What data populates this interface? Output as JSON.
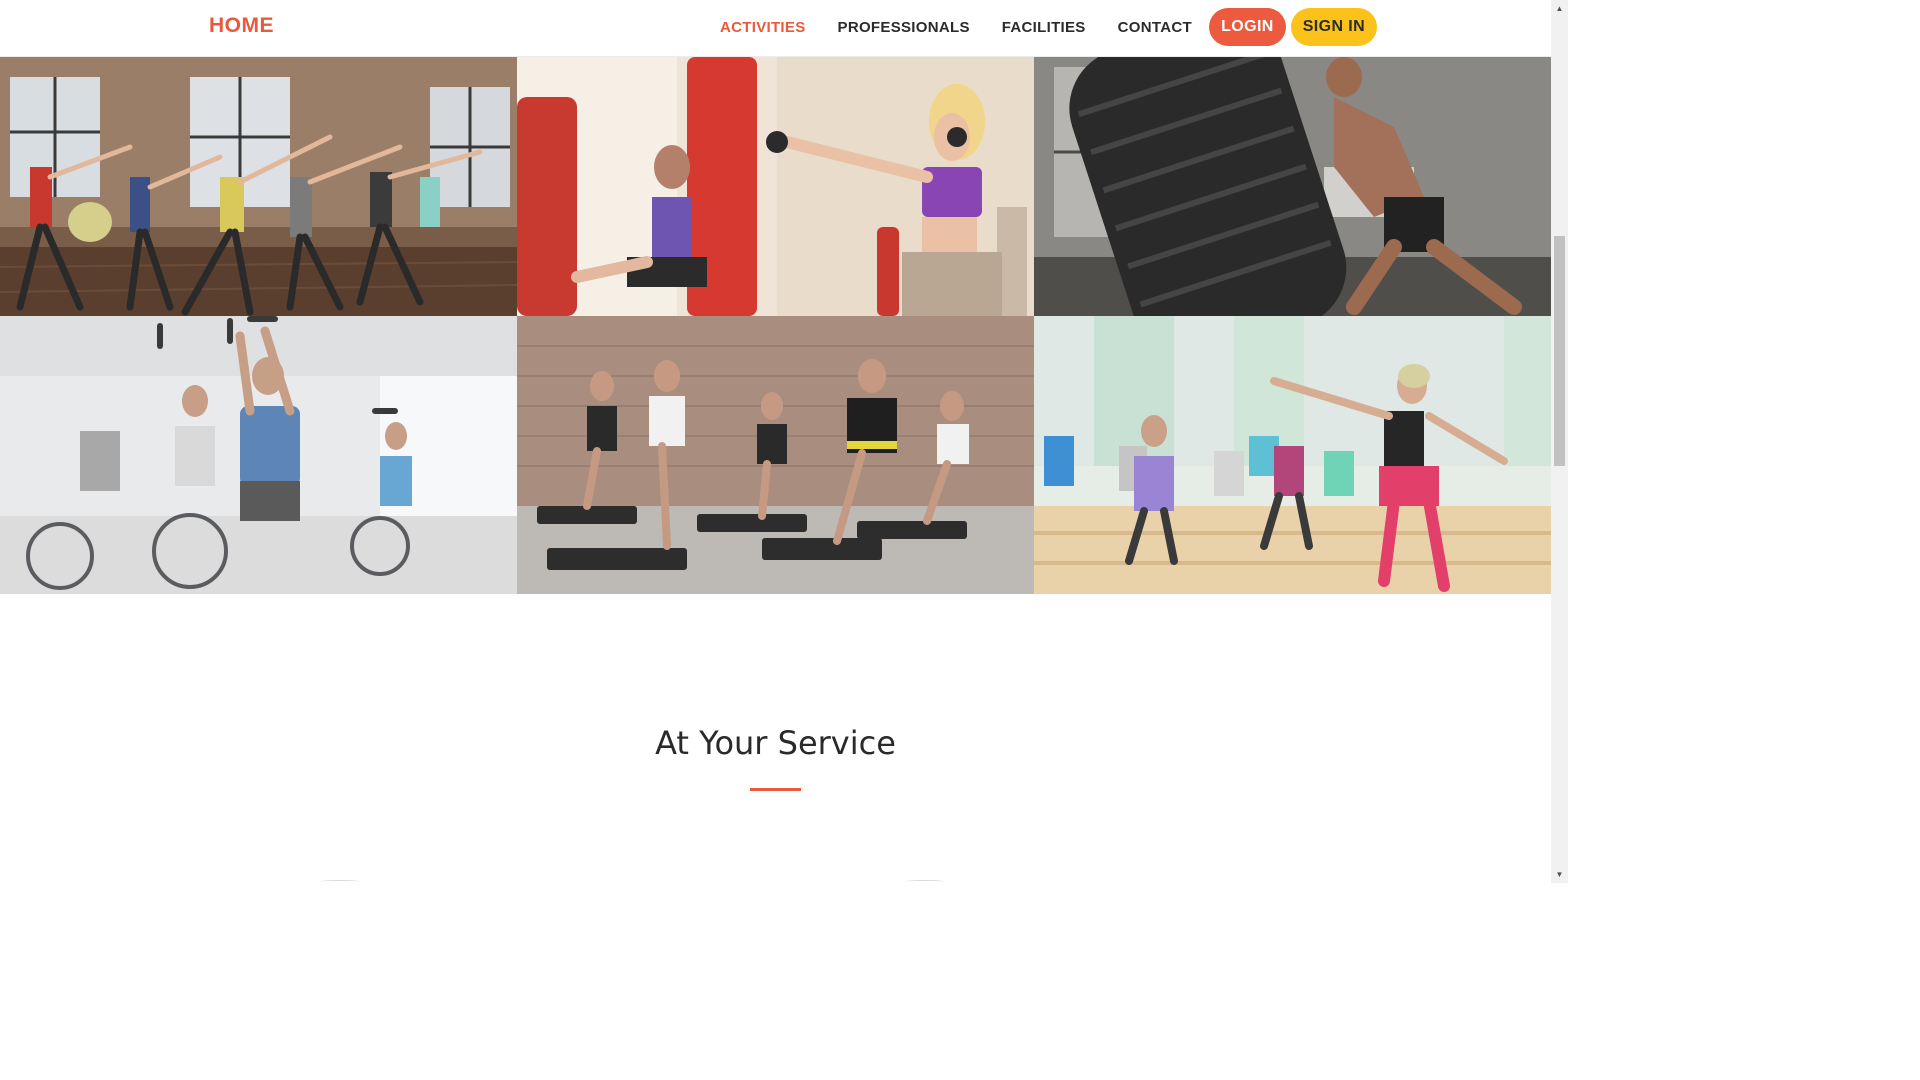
{
  "nav": {
    "brand": "HOME",
    "links": [
      {
        "label": "ACTIVITIES",
        "active": true
      },
      {
        "label": "PROFESSIONALS",
        "active": false
      },
      {
        "label": "FACILITIES",
        "active": false
      },
      {
        "label": "CONTACT",
        "active": false
      }
    ],
    "login_label": "LOGIN",
    "signin_label": "SIGN IN"
  },
  "gallery": {
    "tiles": [
      {
        "icon": "stretching-class-photo"
      },
      {
        "icon": "kickboxing-photo"
      },
      {
        "icon": "tire-flip-photo"
      },
      {
        "icon": "spin-class-photo"
      },
      {
        "icon": "step-aerobics-photo"
      },
      {
        "icon": "dance-fitness-photo"
      }
    ]
  },
  "section": {
    "title": "At Your Service"
  },
  "colors": {
    "accent": "#e9593c",
    "login_bg": "#ec5a3f",
    "signin_bg": "#fcc21c",
    "text": "#2b2b2b"
  },
  "scrollbar": {
    "up_icon": "scroll-up-arrow-icon",
    "down_icon": "scroll-down-arrow-icon"
  }
}
